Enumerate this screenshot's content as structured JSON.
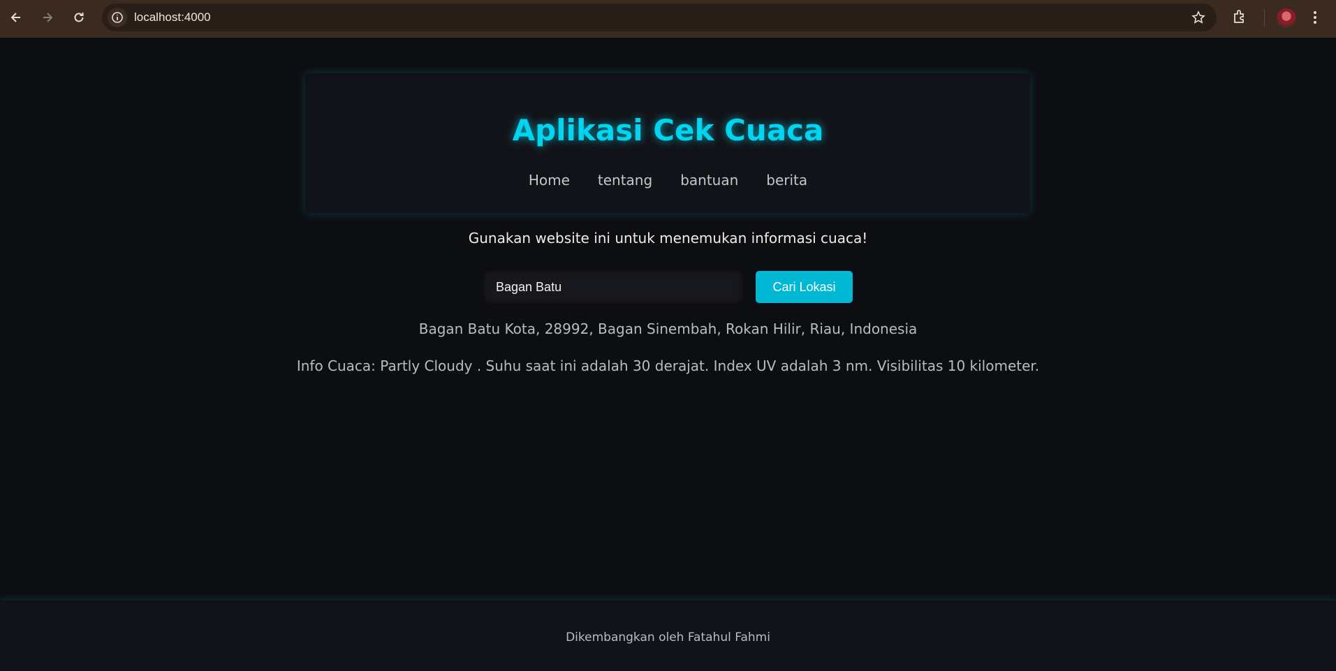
{
  "browser": {
    "url": "localhost:4000",
    "icons": [
      "back-icon",
      "forward-icon",
      "reload-icon",
      "site-info-icon",
      "bookmark-star-icon",
      "extensions-icon",
      "profile-avatar",
      "menu-icon"
    ]
  },
  "header": {
    "title": "Aplikasi Cek Cuaca",
    "nav": [
      {
        "label": "Home"
      },
      {
        "label": "tentang"
      },
      {
        "label": "bantuan"
      },
      {
        "label": "berita"
      }
    ]
  },
  "main": {
    "tagline": "Gunakan website ini untuk menemukan informasi cuaca!",
    "search": {
      "value": "Bagan Batu",
      "button_label": "Cari Lokasi"
    },
    "location": "Bagan Batu Kota, 28992, Bagan Sinembah, Rokan Hilir, Riau, Indonesia",
    "weather_info": "Info Cuaca: Partly Cloudy . Suhu saat ini adalah 30 derajat. Index UV adalah 3 nm. Visibilitas 10 kilometer."
  },
  "footer": {
    "text": "Dikembangkan oleh Fatahul Fahmi"
  },
  "colors": {
    "accent": "#00d4ef",
    "button": "#00b8d4",
    "background": "#0d0e12",
    "chrome": "#3a2a20"
  }
}
